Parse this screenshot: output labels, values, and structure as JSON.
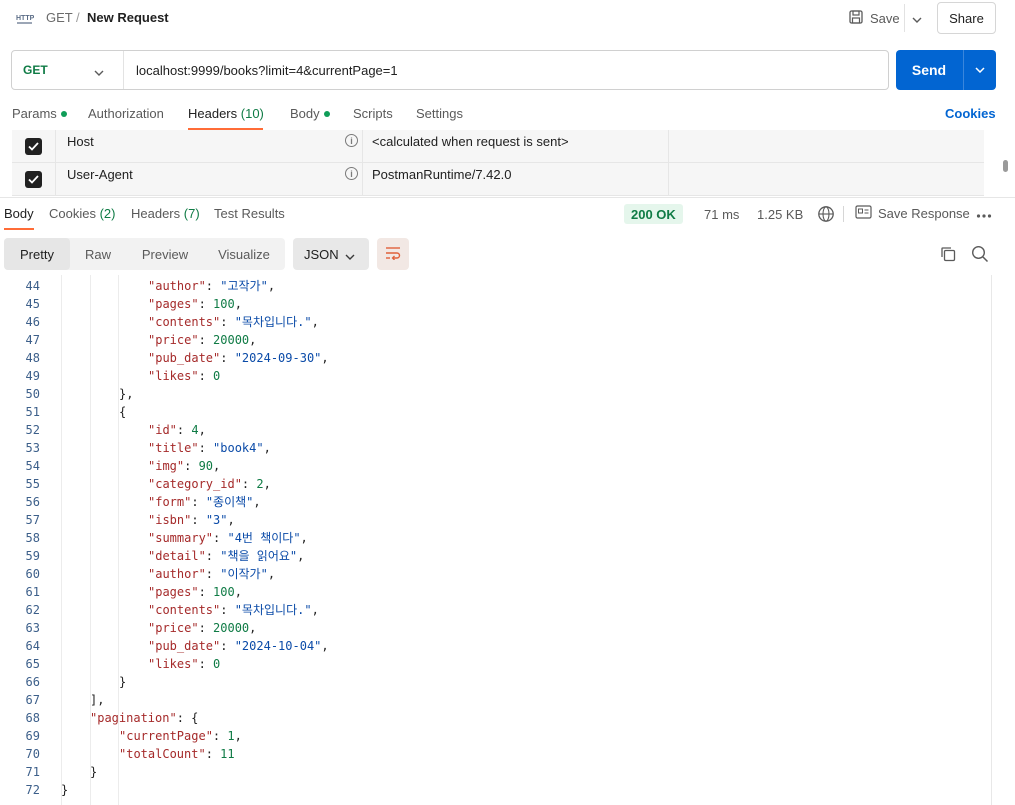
{
  "header": {
    "method": "GET",
    "separator": "/",
    "request_name": "New Request",
    "save_label": "Save",
    "share_label": "Share"
  },
  "url_bar": {
    "method": "GET",
    "url": "localhost:9999/books?limit=4&currentPage=1",
    "send_label": "Send"
  },
  "request_tabs": [
    {
      "label": "Params",
      "dot": true
    },
    {
      "label": "Authorization"
    },
    {
      "label": "Headers",
      "count": "(10)",
      "active": true
    },
    {
      "label": "Body",
      "dot": true
    },
    {
      "label": "Scripts"
    },
    {
      "label": "Settings"
    }
  ],
  "cookies_link": "Cookies",
  "headers_table": [
    {
      "key": "Host",
      "value": "<calculated when request is sent>",
      "checked": true
    },
    {
      "key": "User-Agent",
      "value": "PostmanRuntime/7.42.0",
      "checked": true
    }
  ],
  "response_tabs": [
    {
      "label": "Body",
      "active": true
    },
    {
      "label": "Cookies",
      "count": "(2)"
    },
    {
      "label": "Headers",
      "count": "(7)"
    },
    {
      "label": "Test Results"
    }
  ],
  "response_meta": {
    "status": "200 OK",
    "time": "71 ms",
    "size": "1.25 KB",
    "save_response": "Save Response"
  },
  "view_modes": [
    "Pretty",
    "Raw",
    "Preview",
    "Visualize"
  ],
  "format": "JSON",
  "colors": {
    "send": "#0265d2",
    "accent": "#ff6c37",
    "status_ok": "#0f7b45"
  },
  "code_lines": [
    {
      "n": "44",
      "indent": 3,
      "tokens": [
        [
          "k",
          "\"author\""
        ],
        [
          "p",
          ": "
        ],
        [
          "s",
          "\"고작가\""
        ],
        [
          "p",
          ","
        ]
      ]
    },
    {
      "n": "45",
      "indent": 3,
      "tokens": [
        [
          "k",
          "\"pages\""
        ],
        [
          "p",
          ": "
        ],
        [
          "n",
          "100"
        ],
        [
          "p",
          ","
        ]
      ]
    },
    {
      "n": "46",
      "indent": 3,
      "tokens": [
        [
          "k",
          "\"contents\""
        ],
        [
          "p",
          ": "
        ],
        [
          "s",
          "\"목차입니다.\""
        ],
        [
          "p",
          ","
        ]
      ]
    },
    {
      "n": "47",
      "indent": 3,
      "tokens": [
        [
          "k",
          "\"price\""
        ],
        [
          "p",
          ": "
        ],
        [
          "n",
          "20000"
        ],
        [
          "p",
          ","
        ]
      ]
    },
    {
      "n": "48",
      "indent": 3,
      "tokens": [
        [
          "k",
          "\"pub_date\""
        ],
        [
          "p",
          ": "
        ],
        [
          "s",
          "\"2024-09-30\""
        ],
        [
          "p",
          ","
        ]
      ]
    },
    {
      "n": "49",
      "indent": 3,
      "tokens": [
        [
          "k",
          "\"likes\""
        ],
        [
          "p",
          ": "
        ],
        [
          "n",
          "0"
        ]
      ]
    },
    {
      "n": "50",
      "indent": 2,
      "tokens": [
        [
          "p",
          "},"
        ]
      ]
    },
    {
      "n": "51",
      "indent": 2,
      "tokens": [
        [
          "p",
          "{"
        ]
      ]
    },
    {
      "n": "52",
      "indent": 3,
      "tokens": [
        [
          "k",
          "\"id\""
        ],
        [
          "p",
          ": "
        ],
        [
          "n",
          "4"
        ],
        [
          "p",
          ","
        ]
      ]
    },
    {
      "n": "53",
      "indent": 3,
      "tokens": [
        [
          "k",
          "\"title\""
        ],
        [
          "p",
          ": "
        ],
        [
          "s",
          "\"book4\""
        ],
        [
          "p",
          ","
        ]
      ]
    },
    {
      "n": "54",
      "indent": 3,
      "tokens": [
        [
          "k",
          "\"img\""
        ],
        [
          "p",
          ": "
        ],
        [
          "n",
          "90"
        ],
        [
          "p",
          ","
        ]
      ]
    },
    {
      "n": "55",
      "indent": 3,
      "tokens": [
        [
          "k",
          "\"category_id\""
        ],
        [
          "p",
          ": "
        ],
        [
          "n",
          "2"
        ],
        [
          "p",
          ","
        ]
      ]
    },
    {
      "n": "56",
      "indent": 3,
      "tokens": [
        [
          "k",
          "\"form\""
        ],
        [
          "p",
          ": "
        ],
        [
          "s",
          "\"종이책\""
        ],
        [
          "p",
          ","
        ]
      ]
    },
    {
      "n": "57",
      "indent": 3,
      "tokens": [
        [
          "k",
          "\"isbn\""
        ],
        [
          "p",
          ": "
        ],
        [
          "s",
          "\"3\""
        ],
        [
          "p",
          ","
        ]
      ]
    },
    {
      "n": "58",
      "indent": 3,
      "tokens": [
        [
          "k",
          "\"summary\""
        ],
        [
          "p",
          ": "
        ],
        [
          "s",
          "\"4번 책이다\""
        ],
        [
          "p",
          ","
        ]
      ]
    },
    {
      "n": "59",
      "indent": 3,
      "tokens": [
        [
          "k",
          "\"detail\""
        ],
        [
          "p",
          ": "
        ],
        [
          "s",
          "\"책을 읽어요\""
        ],
        [
          "p",
          ","
        ]
      ]
    },
    {
      "n": "60",
      "indent": 3,
      "tokens": [
        [
          "k",
          "\"author\""
        ],
        [
          "p",
          ": "
        ],
        [
          "s",
          "\"이작가\""
        ],
        [
          "p",
          ","
        ]
      ]
    },
    {
      "n": "61",
      "indent": 3,
      "tokens": [
        [
          "k",
          "\"pages\""
        ],
        [
          "p",
          ": "
        ],
        [
          "n",
          "100"
        ],
        [
          "p",
          ","
        ]
      ]
    },
    {
      "n": "62",
      "indent": 3,
      "tokens": [
        [
          "k",
          "\"contents\""
        ],
        [
          "p",
          ": "
        ],
        [
          "s",
          "\"목차입니다.\""
        ],
        [
          "p",
          ","
        ]
      ]
    },
    {
      "n": "63",
      "indent": 3,
      "tokens": [
        [
          "k",
          "\"price\""
        ],
        [
          "p",
          ": "
        ],
        [
          "n",
          "20000"
        ],
        [
          "p",
          ","
        ]
      ]
    },
    {
      "n": "64",
      "indent": 3,
      "tokens": [
        [
          "k",
          "\"pub_date\""
        ],
        [
          "p",
          ": "
        ],
        [
          "s",
          "\"2024-10-04\""
        ],
        [
          "p",
          ","
        ]
      ]
    },
    {
      "n": "65",
      "indent": 3,
      "tokens": [
        [
          "k",
          "\"likes\""
        ],
        [
          "p",
          ": "
        ],
        [
          "n",
          "0"
        ]
      ]
    },
    {
      "n": "66",
      "indent": 2,
      "tokens": [
        [
          "p",
          "}"
        ]
      ]
    },
    {
      "n": "67",
      "indent": 1,
      "tokens": [
        [
          "p",
          "],"
        ]
      ]
    },
    {
      "n": "68",
      "indent": 1,
      "tokens": [
        [
          "k",
          "\"pagination\""
        ],
        [
          "p",
          ": {"
        ]
      ]
    },
    {
      "n": "69",
      "indent": 2,
      "tokens": [
        [
          "k",
          "\"currentPage\""
        ],
        [
          "p",
          ": "
        ],
        [
          "n",
          "1"
        ],
        [
          "p",
          ","
        ]
      ]
    },
    {
      "n": "70",
      "indent": 2,
      "tokens": [
        [
          "k",
          "\"totalCount\""
        ],
        [
          "p",
          ": "
        ],
        [
          "n",
          "11"
        ]
      ]
    },
    {
      "n": "71",
      "indent": 1,
      "tokens": [
        [
          "p",
          "}"
        ]
      ]
    },
    {
      "n": "72",
      "indent": 0,
      "tokens": [
        [
          "p",
          "}"
        ]
      ]
    }
  ]
}
